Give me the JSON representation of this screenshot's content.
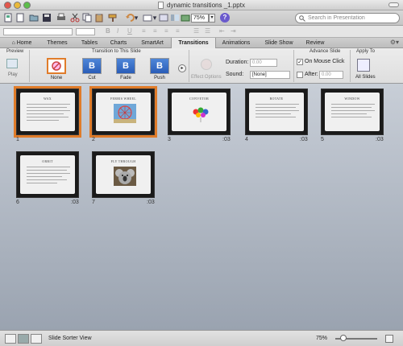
{
  "window": {
    "title": "dynamic transitions _1.pptx"
  },
  "toolbar": {
    "zoom": "75%",
    "search_placeholder": "Search in Presentation"
  },
  "ribbon_tabs": [
    "Home",
    "Themes",
    "Tables",
    "Charts",
    "SmartArt",
    "Transitions",
    "Animations",
    "Slide Show",
    "Review"
  ],
  "active_tab": "Transitions",
  "ribbon": {
    "preview_group": "Preview",
    "play_label": "Play",
    "transition_group": "Transition to This Slide",
    "transitions": [
      {
        "label": "None",
        "glyph": ""
      },
      {
        "label": "Cut",
        "glyph": "B"
      },
      {
        "label": "Fade",
        "glyph": "B"
      },
      {
        "label": "Push",
        "glyph": "B"
      }
    ],
    "effect_options": "Effect Options",
    "duration_label": "Duration:",
    "duration_value": "0.00",
    "sound_label": "Sound:",
    "sound_value": "[None]",
    "advance_group": "Advance Slide",
    "on_mouse_click": "On Mouse Click",
    "after_label": "After:",
    "after_value": "0.00",
    "apply_group": "Apply To",
    "all_slides": "All Slides"
  },
  "slides": [
    {
      "num": "1",
      "title": "WAX",
      "time": ""
    },
    {
      "num": "2",
      "title": "FERRIS WHEEL",
      "time": ""
    },
    {
      "num": "3",
      "title": "CONVETOR",
      "time": ":03"
    },
    {
      "num": "4",
      "title": "ROTATE",
      "time": ":03"
    },
    {
      "num": "5",
      "title": "WINDOW",
      "time": ":03"
    },
    {
      "num": "6",
      "title": "ORBIT",
      "time": ":03"
    },
    {
      "num": "7",
      "title": "FLY THROUGH",
      "time": ":03"
    }
  ],
  "status": {
    "view": "Slide Sorter View",
    "zoom": "75%"
  },
  "colors": {
    "selection": "#e07c2a",
    "accent": "#2a5db8"
  }
}
